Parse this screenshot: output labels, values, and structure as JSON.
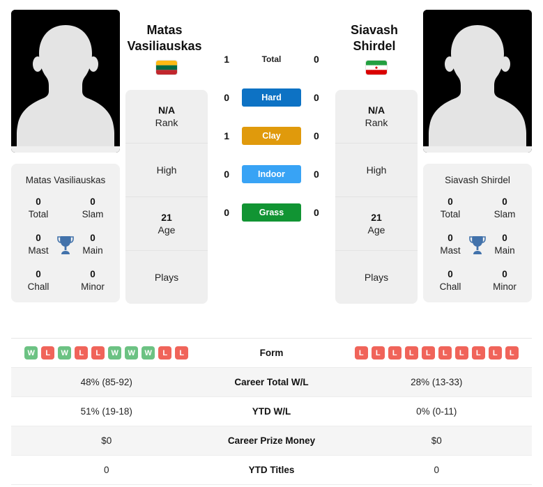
{
  "players": {
    "left": {
      "first_name": "Matas",
      "last_name": "Vasiliauskas",
      "full_name": "Matas Vasiliauskas",
      "country": "Lithuania",
      "flag_icon": "flag-lithuania-icon",
      "rank": "N/A",
      "rank_label": "Rank",
      "high_label": "High",
      "high_value": "",
      "age": "21",
      "age_label": "Age",
      "plays_label": "Plays",
      "plays_value": "",
      "titles": {
        "total": "0",
        "total_label": "Total",
        "slam": "0",
        "slam_label": "Slam",
        "mast": "0",
        "mast_label": "Mast",
        "main": "0",
        "main_label": "Main",
        "chall": "0",
        "chall_label": "Chall",
        "minor": "0",
        "minor_label": "Minor"
      },
      "form": [
        "W",
        "L",
        "W",
        "L",
        "L",
        "W",
        "W",
        "W",
        "L",
        "L"
      ],
      "career_total_wl": "48% (85-92)",
      "ytd_wl": "51% (19-18)",
      "career_prize_money": "$0",
      "ytd_titles": "0"
    },
    "right": {
      "first_name": "Siavash",
      "last_name": "Shirdel",
      "full_name": "Siavash Shirdel",
      "country": "Iran",
      "flag_icon": "flag-iran-icon",
      "rank": "N/A",
      "rank_label": "Rank",
      "high_label": "High",
      "high_value": "",
      "age": "21",
      "age_label": "Age",
      "plays_label": "Plays",
      "plays_value": "",
      "titles": {
        "total": "0",
        "total_label": "Total",
        "slam": "0",
        "slam_label": "Slam",
        "mast": "0",
        "mast_label": "Mast",
        "main": "0",
        "main_label": "Main",
        "chall": "0",
        "chall_label": "Chall",
        "minor": "0",
        "minor_label": "Minor"
      },
      "form": [
        "L",
        "L",
        "L",
        "L",
        "L",
        "L",
        "L",
        "L",
        "L",
        "L"
      ],
      "career_total_wl": "28% (13-33)",
      "ytd_wl": "0% (0-11)",
      "career_prize_money": "$0",
      "ytd_titles": "0"
    }
  },
  "head_to_head": [
    {
      "label": "Total",
      "left": "1",
      "right": "0",
      "color": "transparent",
      "text_color": "#222222"
    },
    {
      "label": "Hard",
      "left": "0",
      "right": "0",
      "color": "#0d72c4",
      "text_color": "#ffffff"
    },
    {
      "label": "Clay",
      "left": "1",
      "right": "0",
      "color": "#e09a0c",
      "text_color": "#ffffff"
    },
    {
      "label": "Indoor",
      "left": "0",
      "right": "0",
      "color": "#38a3f5",
      "text_color": "#ffffff"
    },
    {
      "label": "Grass",
      "left": "0",
      "right": "0",
      "color": "#119433",
      "text_color": "#ffffff"
    }
  ],
  "table": {
    "rows": [
      {
        "label": "Form",
        "left": "",
        "right": "",
        "type": "form"
      },
      {
        "label": "Career Total W/L",
        "left": "48% (85-92)",
        "right": "28% (13-33)",
        "type": "text"
      },
      {
        "label": "YTD W/L",
        "left": "51% (19-18)",
        "right": "0% (0-11)",
        "type": "text"
      },
      {
        "label": "Career Prize Money",
        "left": "$0",
        "right": "$0",
        "type": "text"
      },
      {
        "label": "YTD Titles",
        "left": "0",
        "right": "0",
        "type": "text"
      }
    ]
  },
  "colors": {
    "win_badge": "#6cc283",
    "loss_badge": "#f0645a",
    "trophy": "#4272ab",
    "card_bg": "#f1f1f1",
    "row_alt_bg": "#f5f5f5"
  }
}
